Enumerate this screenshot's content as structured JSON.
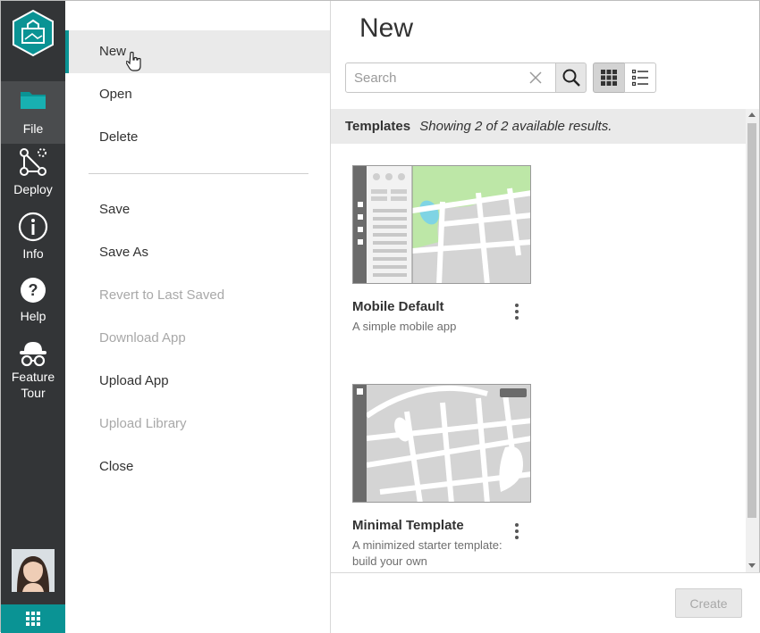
{
  "rail": {
    "items": [
      {
        "label": "File"
      },
      {
        "label": "Deploy"
      },
      {
        "label": "Info"
      },
      {
        "label": "Help"
      },
      {
        "label": "Feature Tour"
      }
    ]
  },
  "menu": {
    "items": [
      {
        "label": "New"
      },
      {
        "label": "Open"
      },
      {
        "label": "Delete"
      },
      {
        "label": "Save"
      },
      {
        "label": "Save As"
      },
      {
        "label": "Revert to Last Saved"
      },
      {
        "label": "Download App"
      },
      {
        "label": "Upload App"
      },
      {
        "label": "Upload Library"
      },
      {
        "label": "Close"
      }
    ]
  },
  "content": {
    "title": "New",
    "search_placeholder": "Search",
    "results_heading": "Templates",
    "results_count": "Showing 2 of 2 available results.",
    "templates": [
      {
        "title": "Mobile Default",
        "description": "A simple mobile app"
      },
      {
        "title": "Minimal Template",
        "description": "A minimized starter template: build your own"
      }
    ],
    "create_label": "Create"
  },
  "colors": {
    "accent": "#0a9394",
    "rail": "#333537",
    "disabled": "#a8a8a8"
  }
}
